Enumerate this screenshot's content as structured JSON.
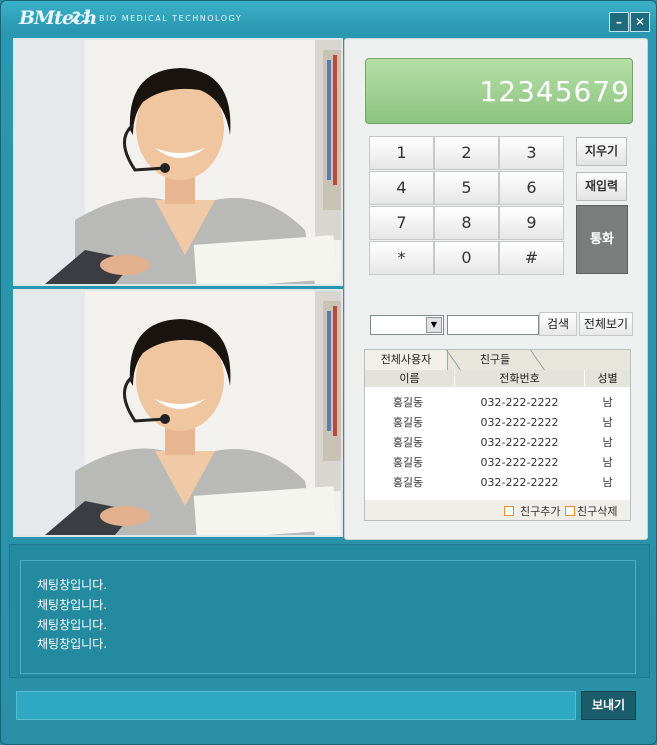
{
  "app": {
    "logo": "BMtech",
    "logo_number": "21",
    "subtitle": "BIO MEDICAL TECHNOLOGY",
    "minimize": "–",
    "close": "✕"
  },
  "dialpad": {
    "display": "12345679",
    "keys": [
      "1",
      "2",
      "3",
      "4",
      "5",
      "6",
      "7",
      "8",
      "9",
      "*",
      "0",
      "#"
    ],
    "erase_label": "지우기",
    "reenter_label": "재입력",
    "call_label": "통화"
  },
  "search": {
    "select_value": "",
    "input_value": "",
    "search_label": "검색",
    "view_all_label": "전체보기"
  },
  "friends": {
    "tabs": [
      "전체사용자",
      "친구들"
    ],
    "columns": [
      "이름",
      "전화번호",
      "성별"
    ],
    "rows": [
      {
        "name": "홍길동",
        "phone": "032-222-2222",
        "gender": "남"
      },
      {
        "name": "홍길동",
        "phone": "032-222-2222",
        "gender": "남"
      },
      {
        "name": "홍길동",
        "phone": "032-222-2222",
        "gender": "남"
      },
      {
        "name": "홍길동",
        "phone": "032-222-2222",
        "gender": "남"
      },
      {
        "name": "홍길동",
        "phone": "032-222-2222",
        "gender": "남"
      }
    ],
    "add_label": "친구추가",
    "delete_label": "친구삭제"
  },
  "chat": {
    "messages": [
      "채팅창입니다.",
      "채팅창입니다.",
      "채팅창입니다.",
      "채팅창입니다."
    ],
    "input_value": "",
    "send_label": "보내기"
  },
  "colors": {
    "window_bg": "#2a8fa6",
    "display_green": "#8cc47f",
    "call_button": "#7b7c7c",
    "checkbox_orange": "#f08a2a"
  }
}
